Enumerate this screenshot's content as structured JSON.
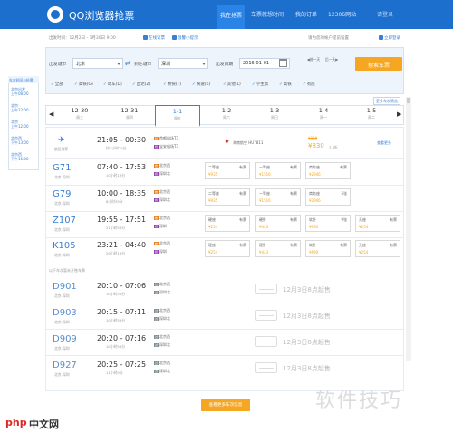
{
  "header": {
    "title": "QQ浏览器抢票",
    "nav": [
      "我在抢票",
      "车票就想时间",
      "我的订单",
      "12306网站"
    ],
    "user": "请登录"
  },
  "info": {
    "text": "出发时间：12月2日 - 1月30日 9:00",
    "links": [
      "在线订票",
      "温馨小提示"
    ],
    "right": "请为您的帐户提前设置",
    "right_link": "立即登录"
  },
  "search": {
    "from_label": "出发城市",
    "from_value": "北京",
    "to_label": "到达城市",
    "to_value": "深圳",
    "date_label": "出发日期",
    "date_value": "2016-01-01",
    "mini_buttons": [
      "前一天",
      "后一天"
    ],
    "button": "搜索车票",
    "filters": [
      "全部",
      "高铁(G)",
      "动车(D)",
      "直达(Z)",
      "特快(T)",
      "快速(K)",
      "其他(L)",
      "学生票",
      "高铁",
      "有座"
    ],
    "more": "更多车次筛选"
  },
  "sidebar": {
    "title": "车次时间与抢票",
    "items": [
      [
        "北京出发",
        "上午08:00"
      ],
      [
        "北京",
        "上午12:00"
      ],
      [
        "北京",
        "上午12:00"
      ],
      [
        "北京西",
        "下午13:00"
      ],
      [
        "北京西",
        "下午16:00"
      ]
    ]
  },
  "dates": [
    {
      "d": "12-30",
      "w": "周三"
    },
    {
      "d": "12-31",
      "w": "周四"
    },
    {
      "d": "1-1",
      "w": "周五"
    },
    {
      "d": "1-2",
      "w": "周六"
    },
    {
      "d": "1-3",
      "w": "周日"
    },
    {
      "d": "1-4",
      "w": "周一"
    },
    {
      "d": "1-5",
      "w": "周二"
    }
  ],
  "flight": {
    "label": "航班推荐",
    "time": "21:05 - 00:30",
    "dur": "约3小时25分",
    "dep": "首都机场T3",
    "arr": "宝安机场T3",
    "airline": "海南航空 HU7811",
    "price_old": "¥920",
    "price": "¥830",
    "discount": "7.5折",
    "link": "查看更多"
  },
  "trains": [
    {
      "code": "G71",
      "sub": "北京-深圳",
      "time": "07:40 - 17:53",
      "dur": "10小时13分",
      "dep": "北京西",
      "arr": "深圳北",
      "seats": [
        {
          "n": "二等座",
          "c": "有票",
          "p": "¥935"
        },
        {
          "n": "一等座",
          "c": "有票",
          "p": "¥1516"
        },
        {
          "n": "商务座",
          "c": "有票",
          "p": "¥2946"
        }
      ]
    },
    {
      "code": "G79",
      "sub": "北京-深圳",
      "time": "10:00 - 18:35",
      "dur": "8小时35分",
      "dep": "北京西",
      "arr": "深圳北",
      "seats": [
        {
          "n": "二等座",
          "c": "有票",
          "p": "¥935"
        },
        {
          "n": "一等座",
          "c": "有票",
          "p": "¥1516"
        },
        {
          "n": "商务座",
          "c": "5张",
          "p": "¥2946"
        }
      ]
    },
    {
      "code": "Z107",
      "sub": "北京-深圳",
      "time": "19:55 - 17:51",
      "dur": "21小时56分",
      "dep": "北京西",
      "arr": "深圳",
      "seats": [
        {
          "n": "硬座",
          "c": "有票",
          "p": "¥254"
        },
        {
          "n": "硬卧",
          "c": "有票",
          "p": "¥443"
        },
        {
          "n": "软卧",
          "c": "9张",
          "p": "¥690"
        },
        {
          "n": "无座",
          "c": "有票",
          "p": "¥254"
        }
      ]
    },
    {
      "code": "K105",
      "sub": "北京-深圳",
      "time": "23:21 - 04:40",
      "dur": "29小时19分",
      "dep": "北京西",
      "arr": "深圳",
      "seats": [
        {
          "n": "硬座",
          "c": "有票",
          "p": "¥254"
        },
        {
          "n": "硬卧",
          "c": "有票",
          "p": "¥443"
        },
        {
          "n": "软卧",
          "c": "有票",
          "p": "¥690"
        },
        {
          "n": "无座",
          "c": "有票",
          "p": "¥254"
        }
      ]
    }
  ],
  "gap_note": "以下车次暂未开售车票",
  "upcoming": [
    {
      "code": "D901",
      "sub": "北京-深圳",
      "time": "20:10 - 07:06",
      "dur": "10小时56分",
      "dep": "北京西",
      "arr": "深圳北",
      "note": "12月3日8点起售"
    },
    {
      "code": "D903",
      "sub": "北京-深圳",
      "time": "20:15 - 07:11",
      "dur": "10小时56分",
      "dep": "北京西",
      "arr": "深圳北",
      "note": "12月3日8点起售"
    },
    {
      "code": "D909",
      "sub": "北京-深圳",
      "time": "20:20 - 07:16",
      "dur": "10小时56分",
      "dep": "北京西",
      "arr": "深圳北",
      "note": "12月3日8点起售"
    },
    {
      "code": "D927",
      "sub": "北京-深圳",
      "time": "20:25 - 07:25",
      "dur": "11小时0分",
      "dep": "北京西",
      "arr": "深圳北",
      "note": "12月3日8点起售"
    }
  ],
  "more_button": "查看更多车次信息",
  "watermarks": {
    "php": "php",
    "cn": "中文网",
    "big": "软件技巧"
  },
  "colors": {
    "header": "#1d6fcd",
    "accent": "#3a7fd4",
    "button": "#f5a623"
  }
}
